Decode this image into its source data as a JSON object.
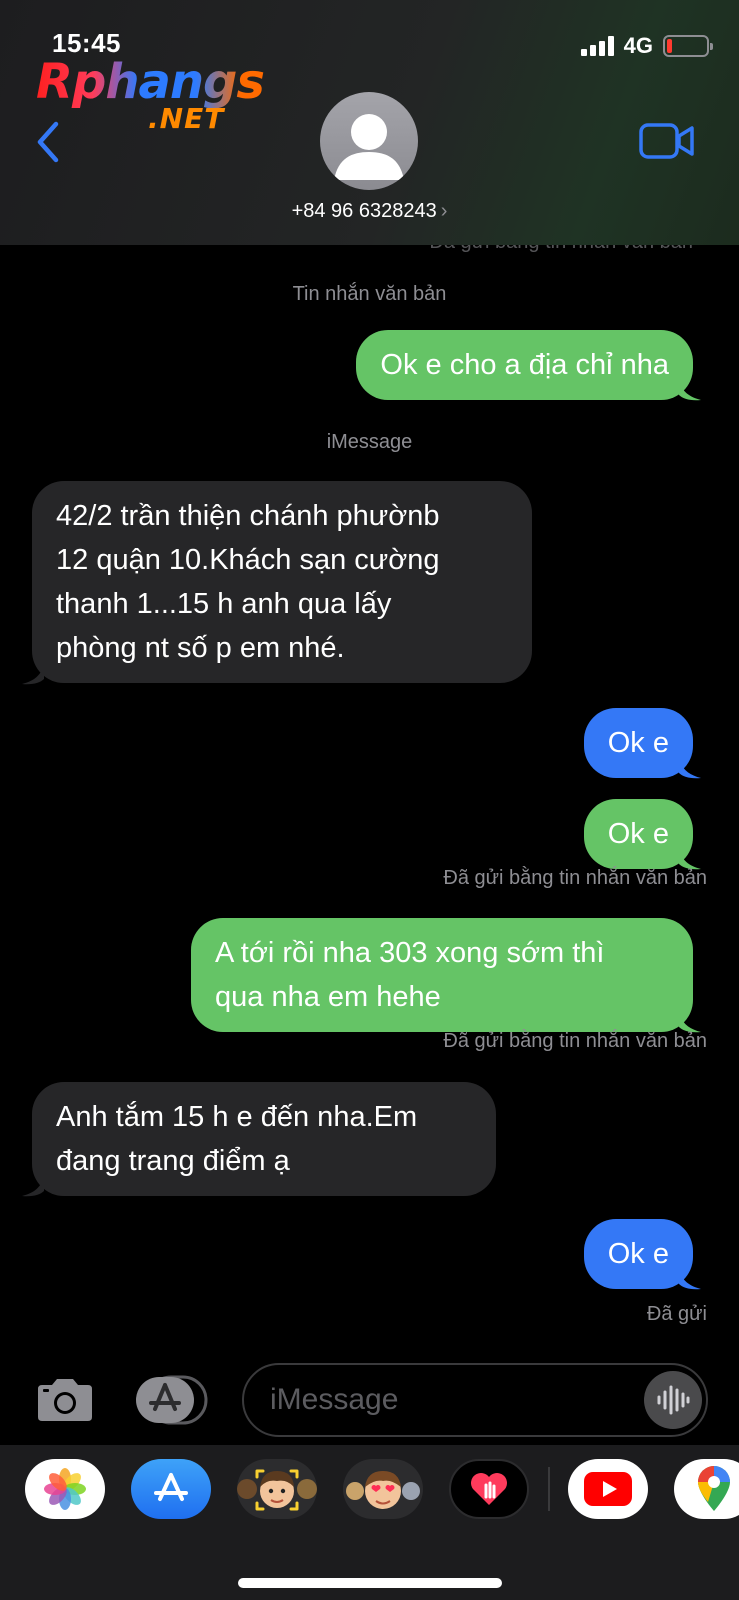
{
  "status_bar": {
    "time": "15:45",
    "network": "4G"
  },
  "logo": {
    "main": "Rphangs",
    "sub": ".NET"
  },
  "contact": {
    "number": "+84 96 6328243",
    "chevron": "›"
  },
  "chat": {
    "peek_label": "Đã gửi bằng tin nhắn văn bản",
    "labels": {
      "text_message": "Tin nhắn văn bản",
      "imessage": "iMessage",
      "sent_as_text_1": "Đã gửi bằng tin nhắn văn bản",
      "sent_as_text_2": "Đã gửi bằng tin nhắn văn bản",
      "delivered": "Đã gửi"
    },
    "messages": [
      {
        "kind": "sent-sms",
        "lines": [
          "Ok e cho a địa chỉ nha"
        ]
      },
      {
        "kind": "received",
        "lines": [
          "42/2 trần thiện chánh phườnb",
          "12 quận 10.Khách sạn cường",
          "thanh 1...15 h anh qua lấy",
          "phòng nt số p em nhé."
        ]
      },
      {
        "kind": "sent-imessage",
        "lines": [
          "Ok e"
        ]
      },
      {
        "kind": "sent-sms",
        "lines": [
          "Ok e"
        ]
      },
      {
        "kind": "sent-sms",
        "lines": [
          "A tới rồi nha 303 xong sớm thì",
          "qua nha em hehe"
        ]
      },
      {
        "kind": "received",
        "lines": [
          "Anh tắm 15 h e đến nha.Em",
          "đang trang điểm ạ"
        ]
      },
      {
        "kind": "sent-imessage",
        "lines": [
          "Ok e"
        ]
      }
    ]
  },
  "input": {
    "placeholder": "iMessage"
  },
  "colors": {
    "sms_green": "#65c466",
    "imessage_blue": "#3478f6",
    "received_gray": "#262628",
    "accent_blue": "#3478f6"
  },
  "app_strip": [
    "photos-icon",
    "app-store-icon",
    "memoji-icon",
    "memoji-stickers-icon",
    "digital-touch-icon",
    "youtube-icon",
    "maps-icon"
  ]
}
